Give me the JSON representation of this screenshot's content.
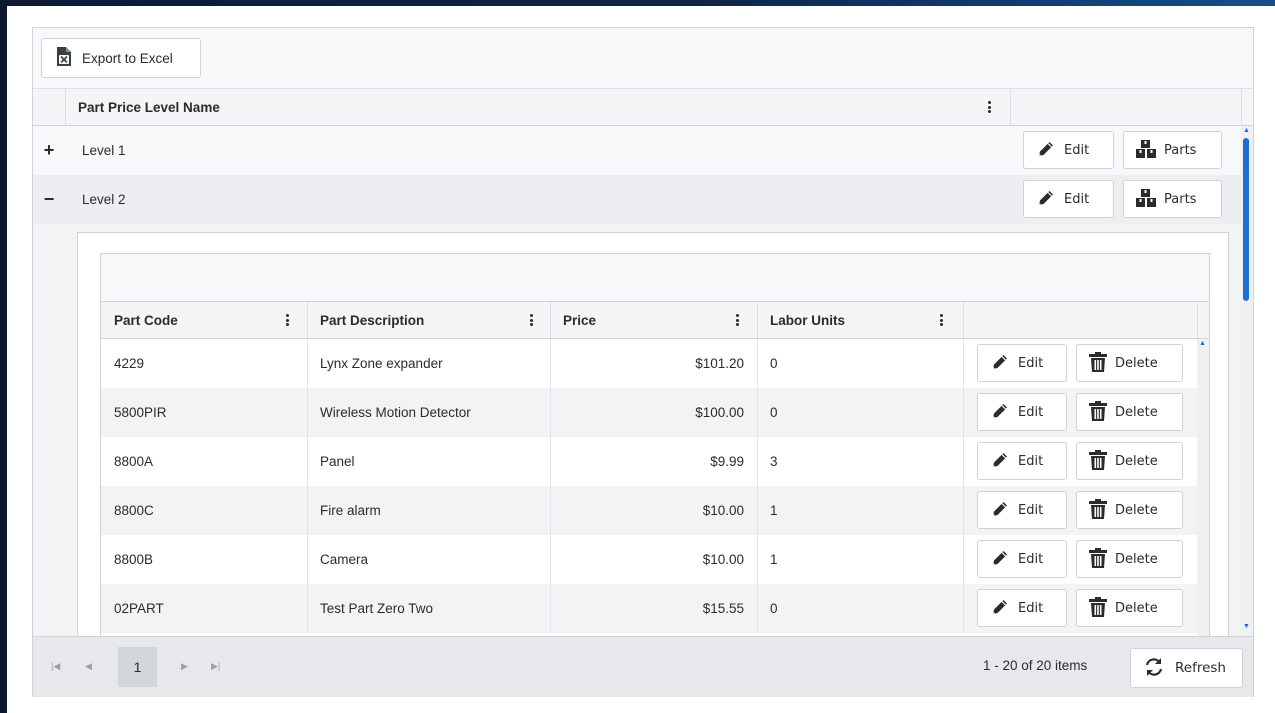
{
  "toolbar": {
    "export_label": "Export to Excel"
  },
  "master": {
    "column_header": "Part Price Level Name",
    "rows": [
      {
        "toggle": "+",
        "name": "Level 1",
        "edit": "Edit",
        "parts": "Parts"
      },
      {
        "toggle": "−",
        "name": "Level 2",
        "edit": "Edit",
        "parts": "Parts"
      }
    ]
  },
  "detail": {
    "columns": [
      "Part Code",
      "Part Description",
      "Price",
      "Labor Units"
    ],
    "rows": [
      {
        "code": "4229",
        "description": "Lynx Zone expander",
        "price": "$101.20",
        "labor": "0",
        "edit": "Edit",
        "delete": "Delete"
      },
      {
        "code": "5800PIR",
        "description": "Wireless Motion Detector",
        "price": "$100.00",
        "labor": "0",
        "edit": "Edit",
        "delete": "Delete"
      },
      {
        "code": "8800A",
        "description": "Panel",
        "price": "$9.99",
        "labor": "3",
        "edit": "Edit",
        "delete": "Delete"
      },
      {
        "code": "8800C",
        "description": "Fire alarm",
        "price": "$10.00",
        "labor": "1",
        "edit": "Edit",
        "delete": "Delete"
      },
      {
        "code": "8800B",
        "description": "Camera",
        "price": "$10.00",
        "labor": "1",
        "edit": "Edit",
        "delete": "Delete"
      },
      {
        "code": "02PART",
        "description": "Test Part Zero Two",
        "price": "$15.55",
        "labor": "0",
        "edit": "Edit",
        "delete": "Delete"
      }
    ]
  },
  "pager": {
    "current_page": "1",
    "info": "1 - 20 of 20 items",
    "refresh_label": "Refresh"
  },
  "colors": {
    "accent": "#1c6fd8",
    "header_bg": "#f4f5f7",
    "alt_row": "#f2f3f5",
    "pager_bg": "#e6e8eb"
  },
  "icons": [
    "excel-icon",
    "pencil-icon",
    "boxes-icon",
    "trash-icon",
    "refresh-icon",
    "kebab-menu-icon"
  ]
}
